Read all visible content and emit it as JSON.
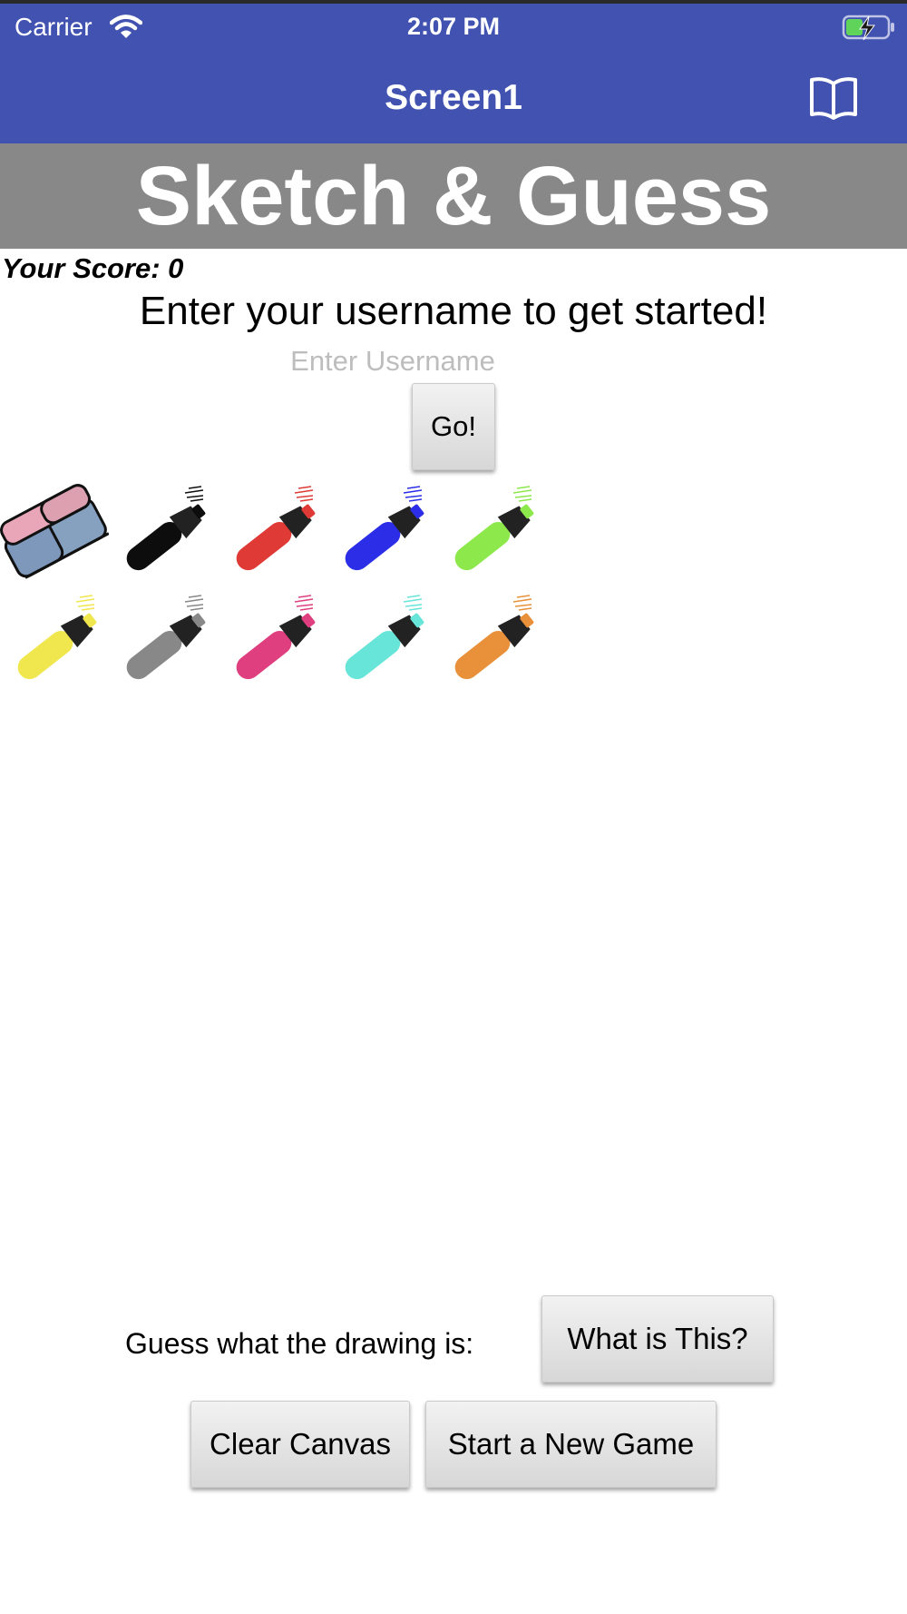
{
  "status_bar": {
    "carrier": "Carrier",
    "time": "2:07 PM"
  },
  "nav": {
    "title": "Screen1",
    "book_icon": "book-icon"
  },
  "banner": {
    "title": "Sketch & Guess",
    "background": "#888888"
  },
  "score": {
    "label": "Your Score: 0"
  },
  "prompt": {
    "text": "Enter your username to get started!"
  },
  "username": {
    "placeholder": "Enter Username",
    "value": ""
  },
  "go_button": {
    "label": "Go!"
  },
  "tools": {
    "eraser": "eraser-icon",
    "markers": [
      {
        "name": "black",
        "color": "#0d0d0d"
      },
      {
        "name": "red",
        "color": "#e03a36"
      },
      {
        "name": "blue",
        "color": "#2b2ee6"
      },
      {
        "name": "green",
        "color": "#8de84c"
      },
      {
        "name": "yellow",
        "color": "#f0e64e"
      },
      {
        "name": "gray",
        "color": "#888888"
      },
      {
        "name": "pink",
        "color": "#e03f7f"
      },
      {
        "name": "cyan",
        "color": "#67e5d8"
      },
      {
        "name": "orange",
        "color": "#e8913a"
      }
    ]
  },
  "guess": {
    "label": "Guess what the drawing is:"
  },
  "buttons": {
    "what_is_this": "What is This?",
    "clear_canvas": "Clear Canvas",
    "new_game": "Start a New Game"
  },
  "colors": {
    "header": "#4152b1",
    "banner": "#888888"
  }
}
